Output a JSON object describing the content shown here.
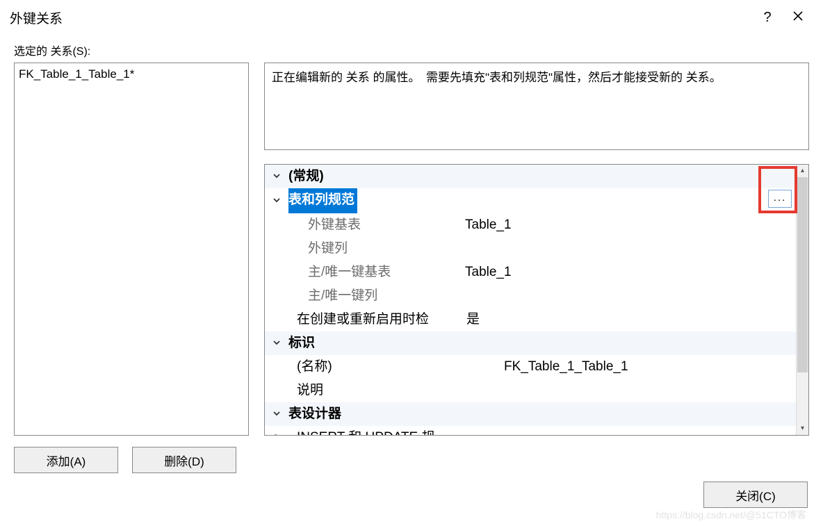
{
  "titlebar": {
    "title": "外键关系"
  },
  "left": {
    "label": "选定的 关系(S):",
    "items": [
      "FK_Table_1_Table_1*"
    ]
  },
  "info": "正在编辑新的 关系 的属性。　需要先填充\"表和列规范\"属性，然后才能接受新的 关系。",
  "grid": {
    "cat_general": "(常规)",
    "row_spec": "表和列规范",
    "row_fk_base_table": "外键基表",
    "val_fk_base_table": "Table_1",
    "row_fk_col": "外键列",
    "row_pk_base_table": "主/唯一键基表",
    "val_pk_base_table": "Table_1",
    "row_pk_col": "主/唯一键列",
    "row_check": "在创建或重新启用时检",
    "val_check": "是",
    "cat_ident": "标识",
    "row_name": "(名称)",
    "val_name": "FK_Table_1_Table_1",
    "row_desc": "说明",
    "cat_designer": "表设计器",
    "row_insert_update": "INSERT 和 UPDATE 规"
  },
  "buttons": {
    "add": "添加(A)",
    "delete": "删除(D)",
    "close": "关闭(C)"
  },
  "ellipsis": "...",
  "watermark": "https://blog.csdn.net/@51CTO博客"
}
